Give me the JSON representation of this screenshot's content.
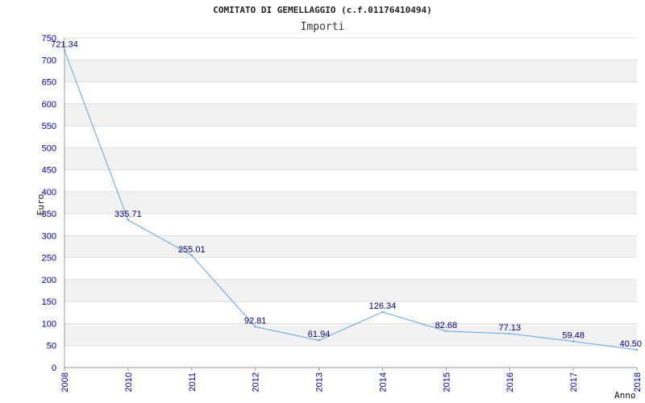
{
  "chart_data": {
    "type": "line",
    "title": "COMITATO DI GEMELLAGGIO (c.f.01176410494)",
    "subtitle": "Importi",
    "xlabel": "Anno",
    "ylabel": "Euro",
    "categories": [
      "2008",
      "2010",
      "2011",
      "2012",
      "2013",
      "2014",
      "2015",
      "2016",
      "2017",
      "2018"
    ],
    "values": [
      721.34,
      335.71,
      255.01,
      92.81,
      61.94,
      126.34,
      82.68,
      77.13,
      59.48,
      40.5
    ],
    "value_labels": [
      "721.34",
      "335.71",
      "255.01",
      "92.81",
      "61.94",
      "126.34",
      "82.68",
      "77.13",
      "59.48",
      "40.50"
    ],
    "ylim": [
      0,
      750
    ],
    "yticks": [
      "0",
      "50",
      "100",
      "150",
      "200",
      "250",
      "300",
      "350",
      "400",
      "450",
      "500",
      "550",
      "600",
      "650",
      "700",
      "750"
    ],
    "grid": "horizontal alternating bands",
    "colors": {
      "line": "#5ba3e8",
      "band": "#f2f2f2",
      "gridline": "#dddddd",
      "axis": "#999999",
      "tick_text": "#0000aa",
      "data_label": "#000080"
    }
  }
}
